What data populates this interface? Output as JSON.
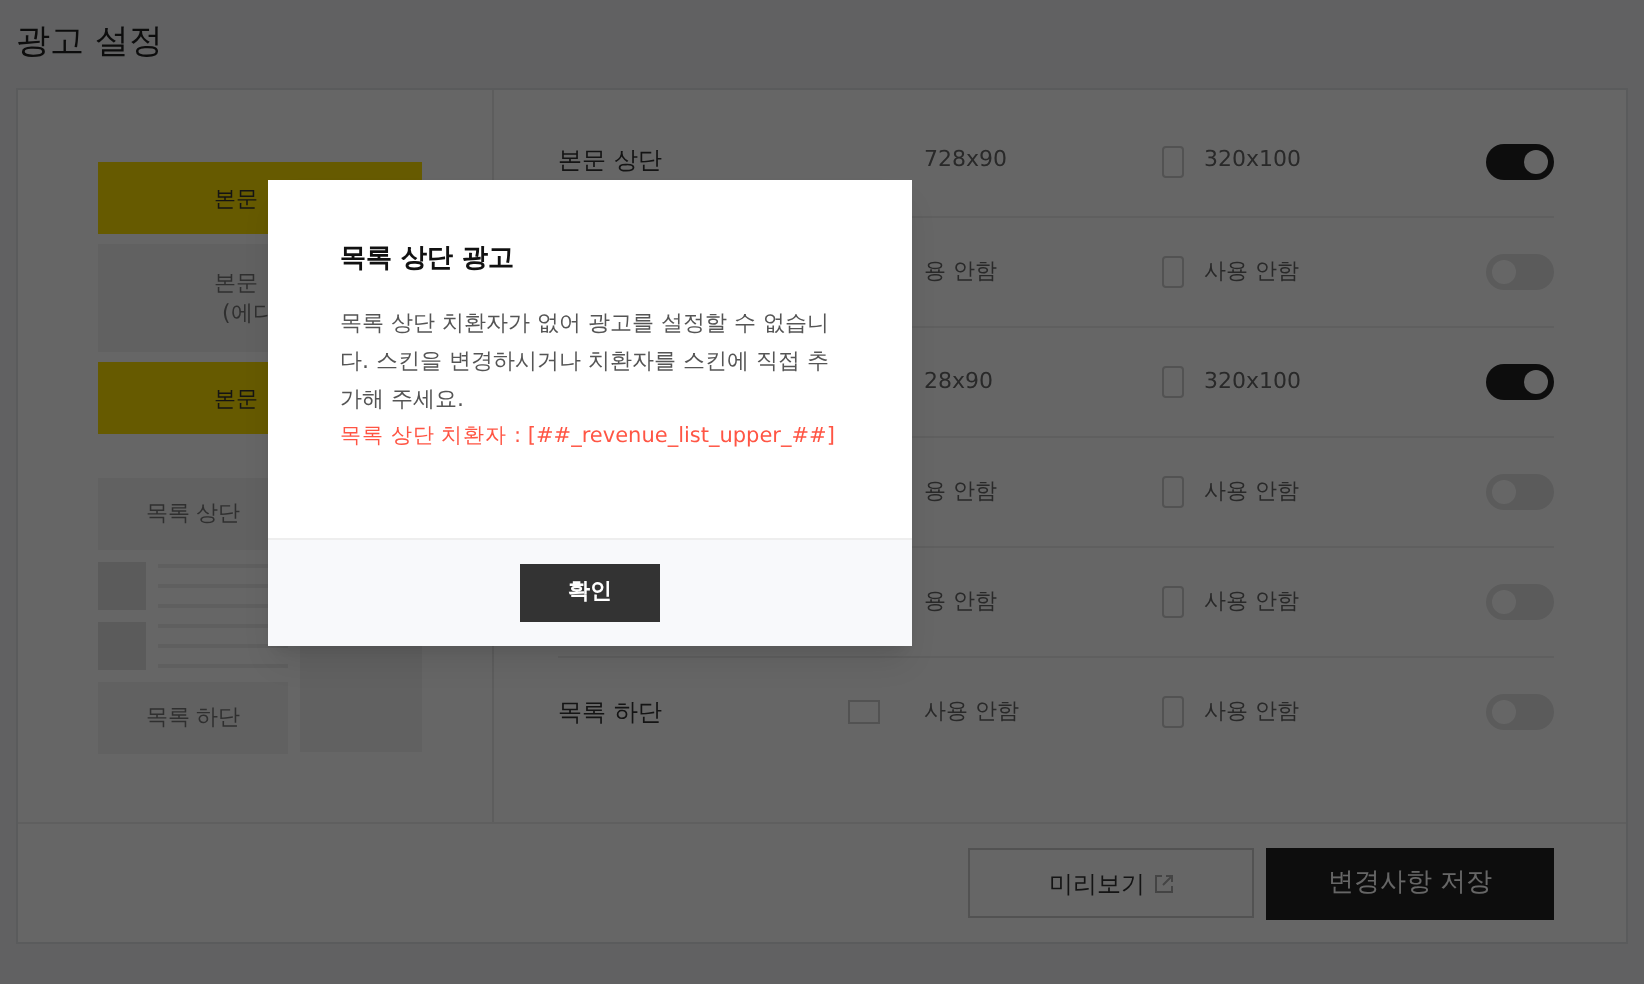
{
  "title": "광고 설정",
  "preview": {
    "blocks": [
      {
        "highlighted": true,
        "lines": [
          "본문"
        ]
      },
      {
        "highlighted": false,
        "lines": [
          "본문",
          "(에디"
        ]
      },
      {
        "highlighted": true,
        "lines": [
          "본문"
        ]
      }
    ],
    "list_top": "목록 상단",
    "list_bottom": "목록 하단"
  },
  "rows": [
    {
      "label": "본문 상단",
      "desktop_icon": false,
      "desktop": "728x90",
      "mobile": "320x100",
      "on": true
    },
    {
      "desktop_icon": false,
      "desktop": "용 안함",
      "mobile": "사용 안함",
      "on": false
    },
    {
      "desktop_icon": false,
      "desktop": "28x90",
      "mobile": "320x100",
      "on": true
    },
    {
      "desktop_icon": false,
      "desktop": "용 안함",
      "mobile": "사용 안함",
      "on": false
    },
    {
      "desktop_icon": false,
      "desktop": "용 안함",
      "mobile": "사용 안함",
      "on": false
    },
    {
      "label": "목록 하단",
      "desktop_icon": true,
      "desktop": "사용 안함",
      "mobile": "사용 안함",
      "on": false
    }
  ],
  "buttons": {
    "preview": "미리보기",
    "save": "변경사항 저장"
  },
  "dialog": {
    "title": "목록 상단 광고",
    "message": "목록 상단 치환자가 없어 광고를 설정할 수 없습니다. 스킨을 변경하시거나 치환자를 스킨에 직접 추가해 주세요.",
    "note": "목록 상단 치환자 : [##_revenue_list_upper_##]",
    "confirm": "확인"
  }
}
